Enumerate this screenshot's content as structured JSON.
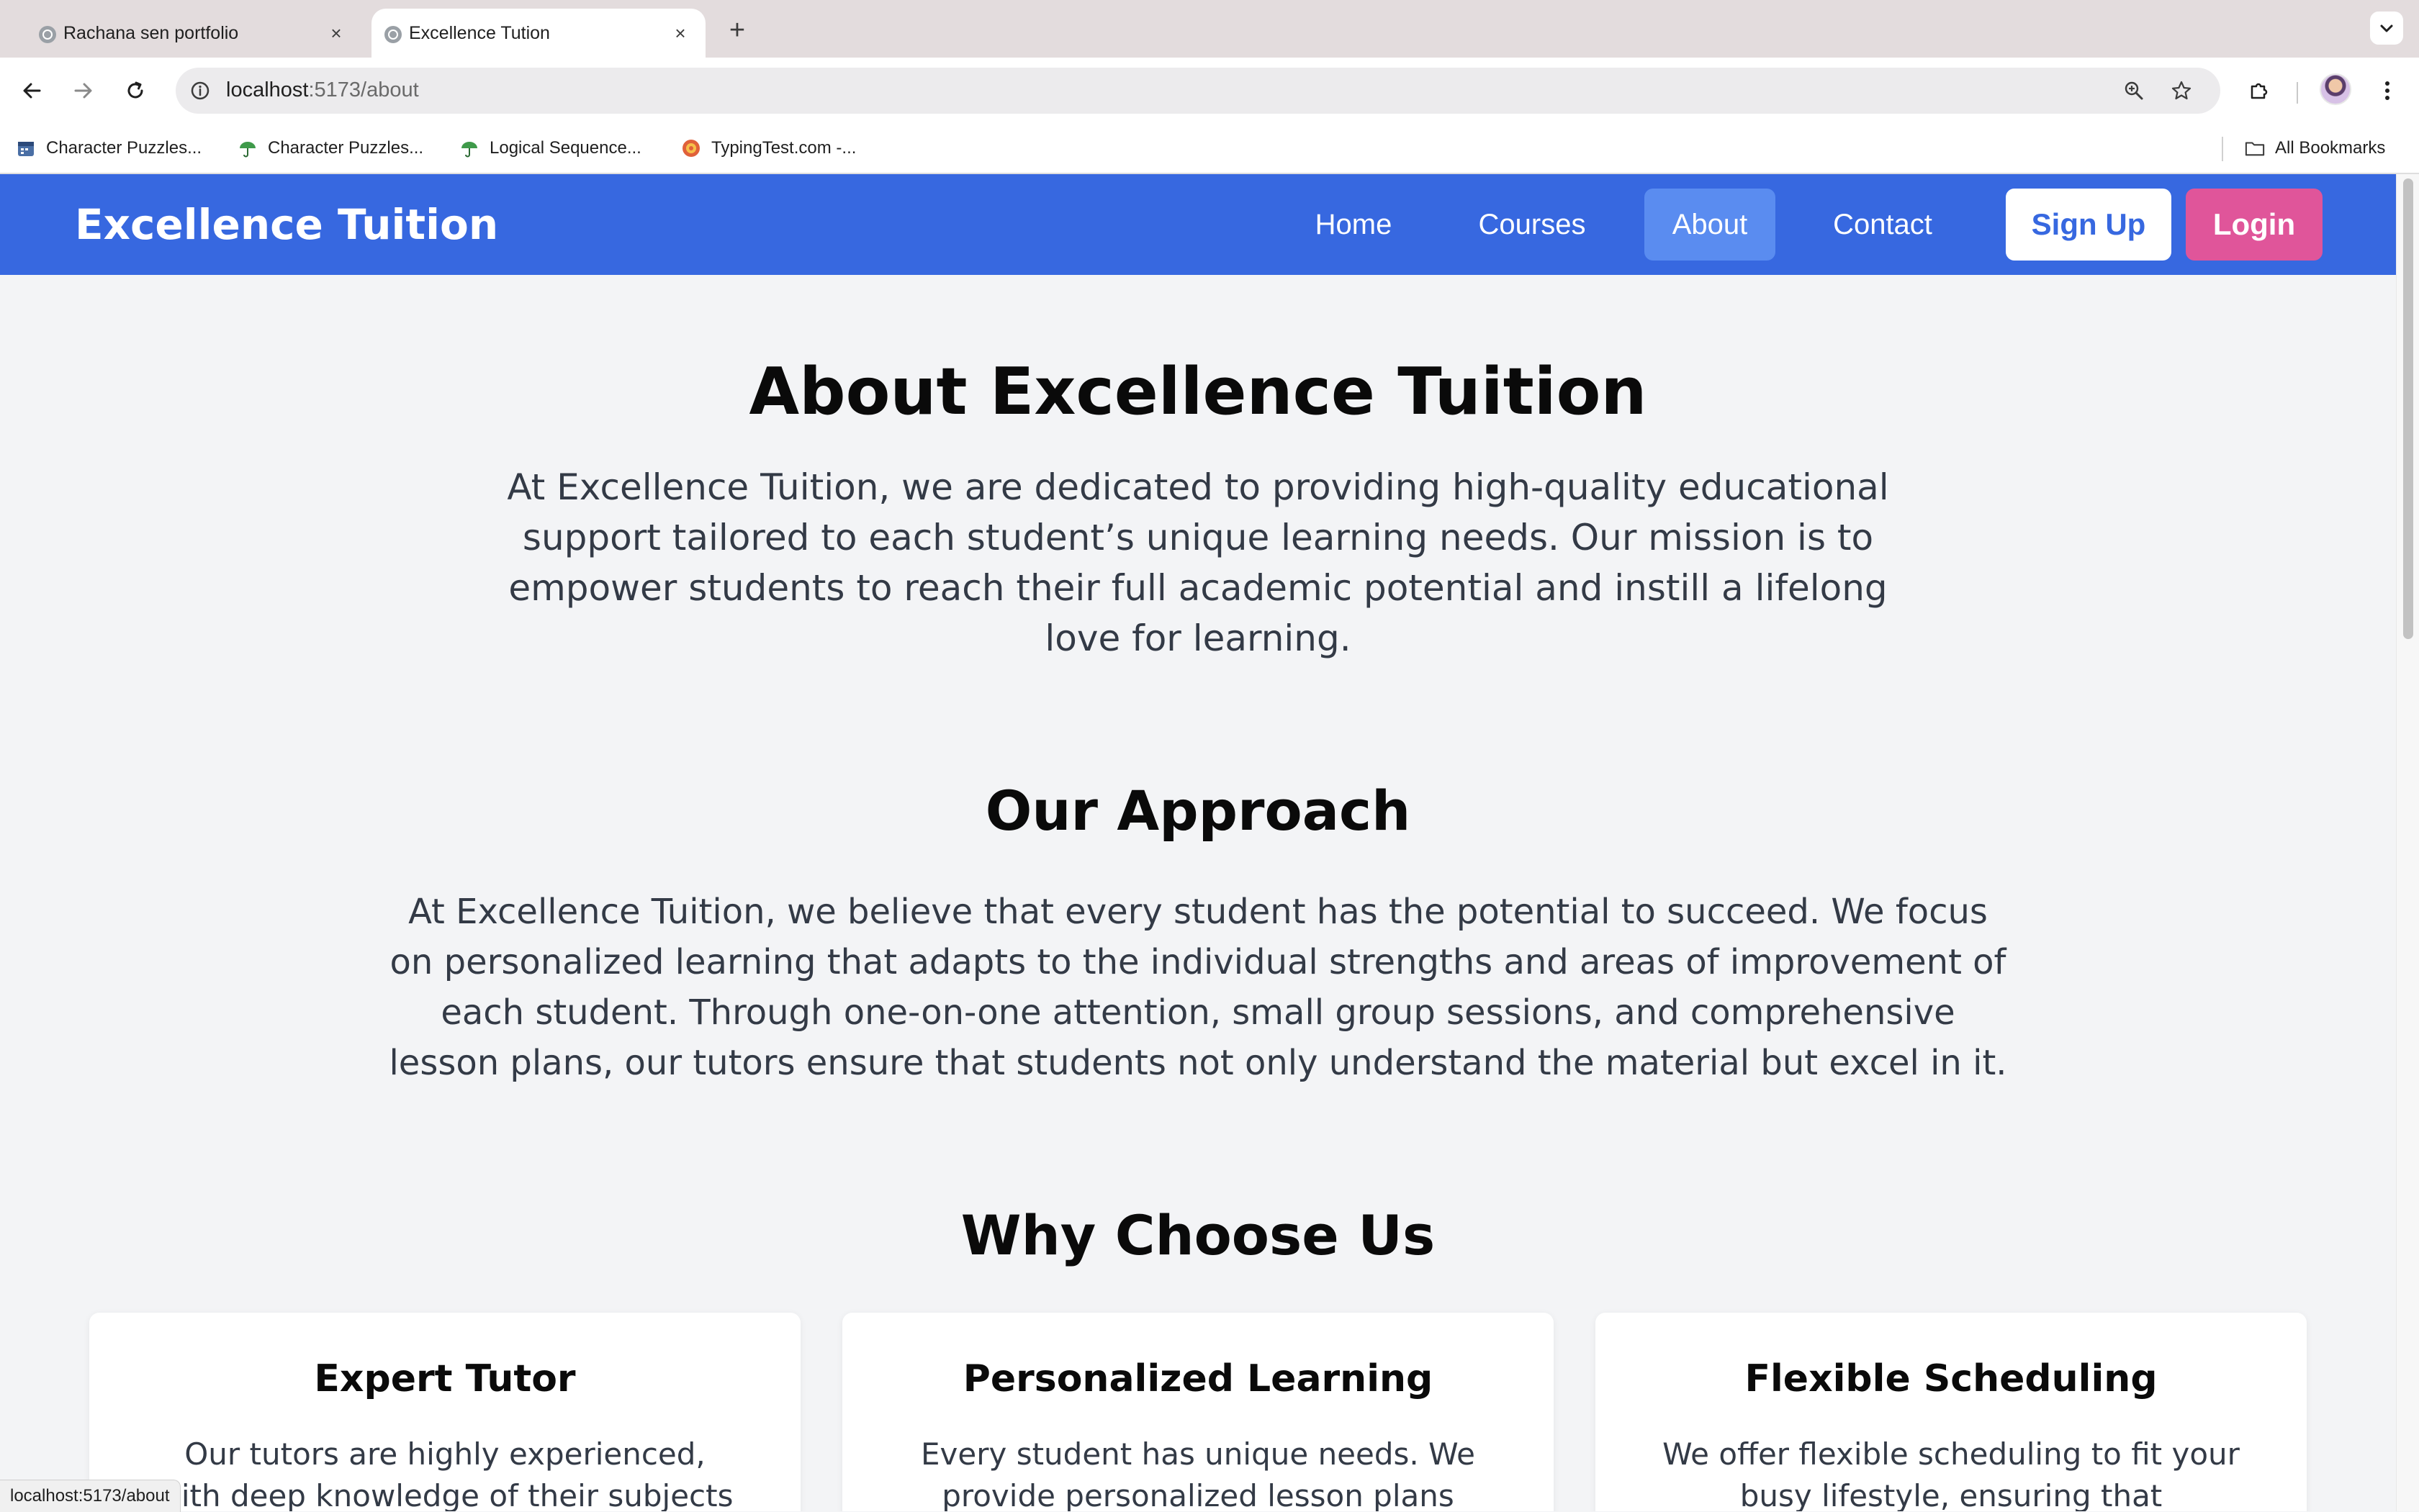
{
  "browser": {
    "tabs": [
      {
        "title": "Rachana sen portfolio",
        "active": false
      },
      {
        "title": "Excellence Tution",
        "active": true
      }
    ],
    "address": {
      "host": "localhost",
      "path": ":5173/about"
    },
    "bookmarks": [
      {
        "label": "Character Puzzles...",
        "icon": "calendar-icon"
      },
      {
        "label": "Character Puzzles...",
        "icon": "umbrella-icon"
      },
      {
        "label": "Logical Sequence...",
        "icon": "umbrella-icon"
      },
      {
        "label": "TypingTest.com -...",
        "icon": "typing-icon"
      }
    ],
    "all_bookmarks_label": "All Bookmarks",
    "status_text": "localhost:5173/about"
  },
  "site": {
    "brand": "Excellence Tuition",
    "nav": {
      "home": "Home",
      "courses": "Courses",
      "about": "About",
      "contact": "Contact",
      "active": "About"
    },
    "signup_label": "Sign Up",
    "login_label": "Login"
  },
  "about": {
    "title": "About Excellence Tuition",
    "text": "At Excellence Tuition, we are dedicated to providing high-quality educational support tailored to each student’s unique learning needs. Our mission is to empower students to reach their full academic potential and instill a lifelong love for learning."
  },
  "approach": {
    "title": "Our Approach",
    "text": "At Excellence Tuition, we believe that every student has the potential to succeed. We focus on personalized learning that adapts to the individual strengths and areas of improvement of each student. Through one-on-one attention, small group sessions, and comprehensive lesson plans, our tutors ensure that students not only understand the material but excel in it."
  },
  "why": {
    "title": "Why Choose Us",
    "cards": [
      {
        "title": "Expert Tutor",
        "text": "Our tutors are highly experienced, with deep knowledge of their subjects and a"
      },
      {
        "title": "Personalized Learning",
        "text": "Every student has unique needs. We provide personalized lesson plans that"
      },
      {
        "title": "Flexible Scheduling",
        "text": "We offer flexible scheduling to fit your busy lifestyle, ensuring that education never"
      }
    ]
  },
  "colors": {
    "nav_bg": "#3768e0",
    "nav_active_bg": "#5a8cf0",
    "login_bg": "#e0559a",
    "page_bg": "#f3f4f6"
  }
}
